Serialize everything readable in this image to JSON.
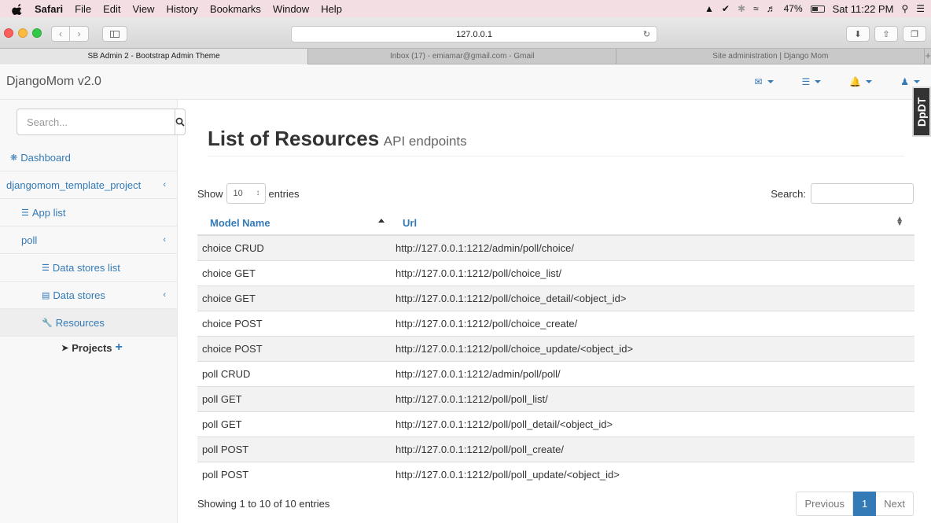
{
  "menubar": {
    "items": [
      "Safari",
      "File",
      "Edit",
      "View",
      "History",
      "Bookmarks",
      "Window",
      "Help"
    ],
    "battery": "47%",
    "clock": "Sat 11:22 PM"
  },
  "browser": {
    "url": "127.0.0.1",
    "tabs": [
      "SB Admin 2 - Bootstrap Admin Theme",
      "Inbox (17) - emiamar@gmail.com - Gmail",
      "Site administration | Django Mom"
    ],
    "new_tab": "+"
  },
  "app": {
    "brand": "DjangoMom v2.0",
    "badge": "DpDT"
  },
  "sidebar": {
    "search_placeholder": "Search...",
    "dashboard": "Dashboard",
    "project": "djangomom_template_project",
    "app_list": "App list",
    "poll": "poll",
    "data_stores_list": "Data stores list",
    "data_stores": "Data stores",
    "resources": "Resources",
    "projects": "Projects"
  },
  "main": {
    "title": "List of Resources",
    "subtitle": "API endpoints",
    "show_label": "Show",
    "entries_value": "10",
    "entries_label": "entries",
    "search_label": "Search:",
    "columns": [
      "Model Name",
      "Url"
    ],
    "rows": [
      [
        "choice CRUD",
        "http://127.0.0.1:1212/admin/poll/choice/"
      ],
      [
        "choice GET",
        "http://127.0.0.1:1212/poll/choice_list/"
      ],
      [
        "choice GET",
        "http://127.0.0.1:1212/poll/choice_detail/<object_id>"
      ],
      [
        "choice POST",
        "http://127.0.0.1:1212/poll/choice_create/"
      ],
      [
        "choice POST",
        "http://127.0.0.1:1212/poll/choice_update/<object_id>"
      ],
      [
        "poll CRUD",
        "http://127.0.0.1:1212/admin/poll/poll/"
      ],
      [
        "poll GET",
        "http://127.0.0.1:1212/poll/poll_list/"
      ],
      [
        "poll GET",
        "http://127.0.0.1:1212/poll/poll_detail/<object_id>"
      ],
      [
        "poll POST",
        "http://127.0.0.1:1212/poll/poll_create/"
      ],
      [
        "poll POST",
        "http://127.0.0.1:1212/poll/poll_update/<object_id>"
      ]
    ],
    "info": "Showing 1 to 10 of 10 entries",
    "pager": {
      "previous": "Previous",
      "current": "1",
      "next": "Next"
    }
  },
  "colors": {
    "link": "#337ab7",
    "sidebar_bg": "#f8f8f8",
    "stripe": "#f2f2f2"
  }
}
